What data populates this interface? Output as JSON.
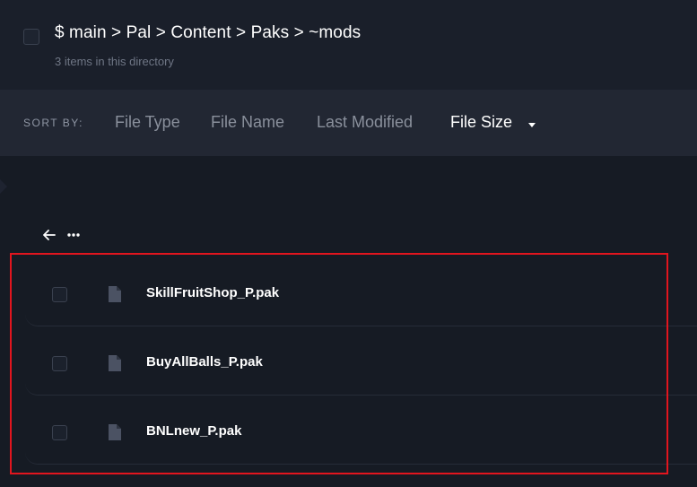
{
  "header": {
    "path": [
      {
        "label": "$ main"
      },
      {
        "label": "Pal"
      },
      {
        "label": "Content"
      },
      {
        "label": "Paks"
      },
      {
        "label": "~mods"
      }
    ],
    "separator": ">",
    "item_count": "3 items in this directory"
  },
  "sort": {
    "label": "SORT BY:",
    "options": [
      {
        "label": "File Type"
      },
      {
        "label": "File Name"
      },
      {
        "label": "Last Modified"
      },
      {
        "label": "File Size"
      }
    ],
    "active": "File Size",
    "direction_icon": "caret-down-icon"
  },
  "nav": {
    "back_icon": "arrow-left-icon",
    "more_icon": "ellipsis-icon"
  },
  "files": [
    {
      "name": "SkillFruitShop_P.pak",
      "icon": "file-icon"
    },
    {
      "name": "BuyAllBalls_P.pak",
      "icon": "file-icon"
    },
    {
      "name": "BNLnew_P.pak",
      "icon": "file-icon"
    }
  ],
  "colors": {
    "background": "#161b24",
    "header_bg": "#1a1f2a",
    "sortbar_bg": "#222733",
    "highlight": "#e1151e",
    "muted_text": "#8a909c",
    "icon": "#4b5263"
  }
}
